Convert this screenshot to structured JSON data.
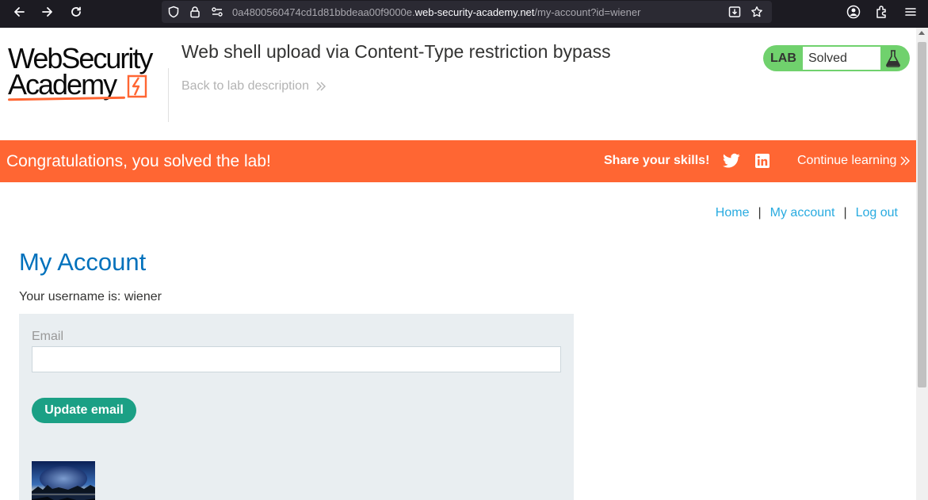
{
  "browser": {
    "url_prefix": "0a4800560474cd1d81bbdeaa00f9000e.",
    "url_host": "web-security-academy.net",
    "url_path": "/my-account?id=wiener"
  },
  "header": {
    "logo_line1": "WebSecurity",
    "logo_line2": "Academy",
    "lab_title": "Web shell upload via Content-Type restriction bypass",
    "back_link": "Back to lab description",
    "status_badge_label": "LAB",
    "status_value": "Solved"
  },
  "banner": {
    "message": "Congratulations, you solved the lab!",
    "share_label": "Share your skills!",
    "continue_label": "Continue learning"
  },
  "nav": {
    "home": "Home",
    "separator": "|",
    "my_account": "My account",
    "log_out": "Log out"
  },
  "account": {
    "title": "My Account",
    "username_text": "Your username is: wiener",
    "email_label": "Email",
    "email_value": "",
    "update_button": "Update email"
  },
  "colors": {
    "brand_orange": "#ff6633",
    "solved_green": "#70d16d",
    "link_blue": "#29abe0",
    "heading_blue": "#0071bc",
    "button_teal": "#1ba085"
  }
}
